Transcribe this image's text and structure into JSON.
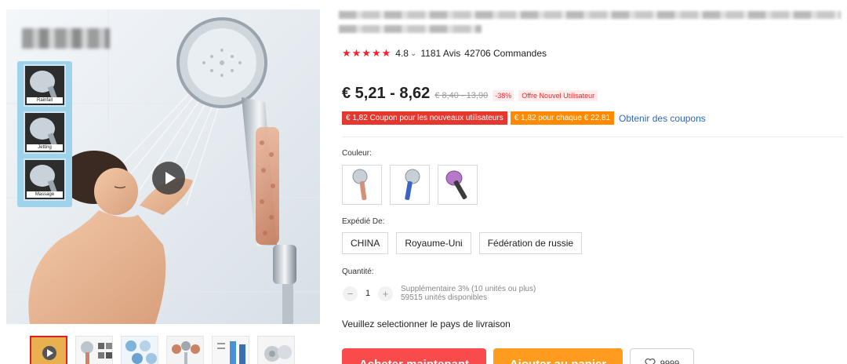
{
  "rating": {
    "stars": "★★★★★",
    "score": "4.8",
    "chevron": "⌄",
    "reviews": "1181 Avis",
    "orders": "42706 Commandes"
  },
  "price": {
    "current": "€ 5,21 - 8,62",
    "original": "€ 8,40 - 13,90",
    "discount": "-38%",
    "offer": "Offre Nouvel Utilisateur"
  },
  "coupons": {
    "new_user": "€ 1,82 Coupon pour les nouveaux utilisateurs",
    "per_spend": "€ 1,82 pour chaque € 22,81",
    "get_link": "Obtenir des coupons"
  },
  "color": {
    "label": "Couleur:",
    "options": [
      "Silver pink",
      "Blue",
      "Purple"
    ]
  },
  "shipping": {
    "label": "Expédié De:",
    "options": [
      "CHINA",
      "Royaume-Uni",
      "Fédération de russie"
    ],
    "note": "Veuillez selectionner le pays de livraison"
  },
  "quantity": {
    "label": "Quantité:",
    "minus": "−",
    "value": "1",
    "plus": "+",
    "extra": "Supplémentaire 3% (10 unités ou plus)",
    "available": "59515 unités disponibles"
  },
  "actions": {
    "buy": "Acheter maintenant",
    "cart": "Ajouter au panier",
    "wishlist_count": "9999"
  },
  "gallery": {
    "feature_captions": [
      "Rainfall",
      "Jetting",
      "Massage"
    ],
    "accent": "#9fd3ec"
  },
  "colors": {
    "brand_red": "#f94b4b",
    "cart_orange": "#ff9b1f",
    "link_blue": "#2e66c6"
  }
}
